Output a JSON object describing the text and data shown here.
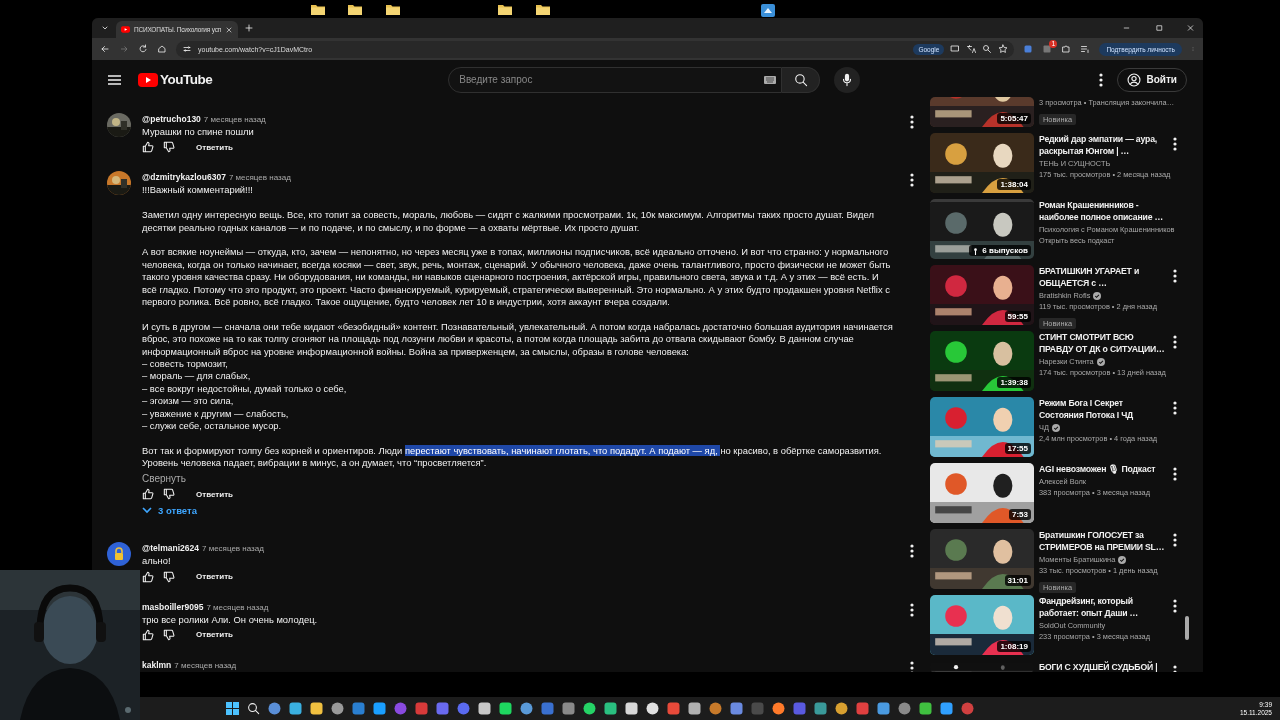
{
  "browser": {
    "tab_title": "ПСИХОПАТЫ. Психология усп",
    "url": "youtube.com/watch?v=cJ1DavMCtro",
    "google_chip": "Google",
    "extension_badge": "1",
    "profile_button": "Подтвердить личность"
  },
  "youtube": {
    "logo": "YouTube",
    "search_placeholder": "Введите запрос",
    "sign_in": "Войти"
  },
  "comments": [
    {
      "author": "@petrucho130",
      "time": "7 месяцев назад",
      "paragraphs": [
        [
          {
            "text": "Мурашки по спине пошли",
            "highlighted": false
          }
        ]
      ],
      "reply": "Ответить"
    },
    {
      "author": "@dzmitrykazlou6307",
      "time": "7 месяцев назад",
      "paragraphs": [
        [
          {
            "text": "!!!Важный комментарий!!!",
            "highlighted": false
          }
        ],
        [
          {
            "text": "Заметил одну интересную вещь. Все, кто топит за совесть, мораль, любовь — сидят с жалкими просмотрами. 1к, 10к максимум. Алгоритмы таких просто душат. Видел десятки реально годных каналов — и по подаче, и по смыслу, и по форме — а охваты мёртвые. Их просто душат.",
            "highlighted": false
          }
        ],
        [
          {
            "text": "А вот всякие ноунеймы — откуда, кто, зачем — непонятно, но через месяц уже в топах, миллионы подписчиков, всё идеально отточено. И вот что странно: у нормального человека, когда он только начинает, всегда косяки — свет, звук, речь, монтаж, сценарий. У обычного человека, даже очень талантливого, просто физически не может быть такого уровня качества сразу. Ни оборудования, ни команды, ни навыков сценарного построения, актёрской игры, правильного света, звука и т.д. А у этих — всё есть. И всё гладко. Потому что это продукт, это проект. Часто финансируемый, курируемый, стратегически выверенный. Это нормально. А у этих будто продакшен уровня Netflix с первого ролика. Всё ровно, всё гладко. Такое ощущение, будто человек лет 10 в индустрии, хотя аккаунт вчера создали.",
            "highlighted": false
          }
        ],
        [
          {
            "text": "И суть в другом — сначала они тебе кидают «безобидный» контент. Познавательный, увлекательный. А потом когда набралась достаточно большая аудитория начинается вброс, это похоже на то как толпу сгоняют на площадь под лозунги любви и красоты, а потом когда площадь забита до отвала скидывают бомбу. В данном случае информационный вброс на уровне информационной войны. Война за приверженцем, за смыслы, образы в голове человека:\n– совесть тормозит,\n– мораль — для слабых,\n– все вокруг недостойны, думай только о себе,\n– эгоизм — это сила,\n– уважение к другим — слабость,\n– служи себе, остальное мусор.",
            "highlighted": false
          }
        ],
        [
          {
            "text": "Вот так и формируют толпу без корней и ориентиров. Люди ",
            "highlighted": false
          },
          {
            "text": "перестают чувствовать, начинают глотать, что подадут. А подают — яд, ",
            "highlighted": true
          },
          {
            "text": "но красиво, в обёртке саморазвития. Уровень человека падает, вибрации в минус, а он думает, что “просветляется”.",
            "highlighted": false
          }
        ]
      ],
      "collapse": "Свернуть",
      "reply": "Ответить",
      "replies": "3 ответа"
    },
    {
      "author": "@telmani2624",
      "time": "7 месяцев назад",
      "avatar": {
        "kind": "lock",
        "color": "#2f62d6"
      },
      "paragraphs": [
        [
          {
            "text": "ально!",
            "highlighted": false
          }
        ]
      ],
      "reply": "Ответить"
    },
    {
      "author": "masboiller9095",
      "time": "7 месяцев назад",
      "paragraphs": [
        [
          {
            "text": "трю все ролики Али. Он очень молодец.",
            "highlighted": false
          }
        ]
      ],
      "reply": "Ответить"
    },
    {
      "author": "kaklmn",
      "time": "7 месяцев назад"
    }
  ],
  "videos": [
    {
      "kind": "video",
      "meta": "3 просмотра • Трансляция закончила…",
      "badge": "Новинка",
      "duration": "5:05:47",
      "menu": false
    },
    {
      "kind": "video",
      "title": "Редкий дар эмпатии — аура, раскрытая Юнгом | …",
      "channel": "ТЕНЬ И СУЩНОСТЬ",
      "verified": false,
      "meta": "175 тыс. просмотров • 2 месяца назад",
      "duration": "1:38:04",
      "menu": true
    },
    {
      "kind": "podcast",
      "title": "Роман Крашенинников - наиболее полное описание …",
      "channel": "Психология с Романом Крашенинников",
      "verified": false,
      "meta": "Открыть весь подкаст",
      "duration": "6 выпусков",
      "menu": false
    },
    {
      "kind": "video",
      "title": "БРАТИШКИН УГАРАЕТ и ОБЩАЕТСЯ с …",
      "channel": "Bratishkin Rofls",
      "verified": true,
      "meta": "119 тыс. просмотров • 2 дня назад",
      "badge": "Новинка",
      "duration": "59:55",
      "menu": true
    },
    {
      "kind": "video",
      "title": "СТИНТ СМОТРИТ ВСЮ ПРАВДУ ОТ ДК о СИТУАЦИИ…",
      "channel": "Нарезки Стинта",
      "verified": true,
      "meta": "174 тыс. просмотров • 13 дней назад",
      "duration": "1:39:38",
      "menu": true
    },
    {
      "kind": "video",
      "title": "Режим Бога I Секрет Состояния Потока I ЧД",
      "channel": "ЧД",
      "verified": true,
      "meta": "2,4 млн просмотров • 4 года назад",
      "duration": "17:55",
      "menu": true
    },
    {
      "kind": "video",
      "title": "AGI невозможен 🎙 Подкаст",
      "channel": "Алексей Волк",
      "verified": false,
      "meta": "383 просмотра • 3 месяца назад",
      "duration": "7:53",
      "menu": true
    },
    {
      "kind": "video",
      "title": "Братишкин ГОЛОСУЕТ за СТРИМЕРОВ на ПРЕМИИ SL…",
      "channel": "Моменты Братишкина",
      "verified": true,
      "meta": "33 тыс. просмотров • 1 день назад",
      "badge": "Новинка",
      "duration": "31:01",
      "menu": true
    },
    {
      "kind": "video",
      "title": "Фандрейзинг, который работает: опыт Даши …",
      "channel": "SoldOut Community",
      "verified": false,
      "meta": "233 просмотра • 3 месяца назад",
      "duration": "1:08:19",
      "menu": true
    },
    {
      "kind": "video",
      "title": "БОГИ С ХУДШЕЙ СУДЬБОЙ |",
      "menu": true
    }
  ],
  "taskbar": {
    "time": "9:39",
    "date": "15.11.2025"
  }
}
